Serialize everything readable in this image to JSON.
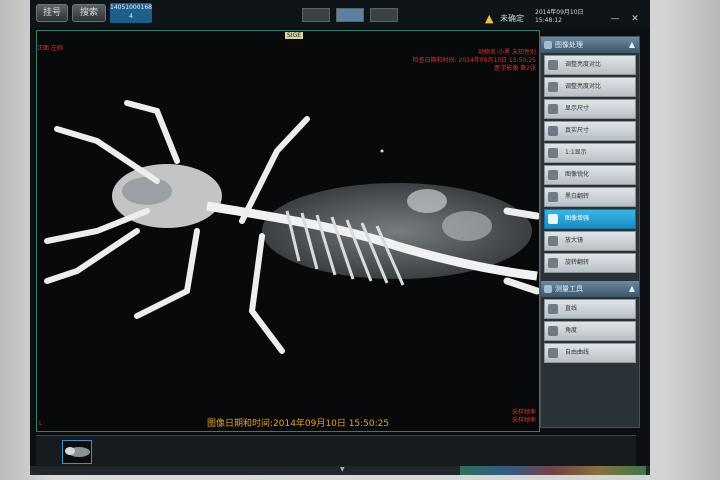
{
  "toolbar": {
    "btn_register": "挂号",
    "btn_search": "搜索",
    "patient_id": "14051000168",
    "id_suffix": "4",
    "warning_text": "未确定",
    "clock_date": "2014年09月10日",
    "clock_time": "15:48:12",
    "btn_minimize": "—",
    "btn_close": "✕"
  },
  "viewport": {
    "corner_tl": "正面 左侧",
    "marker": "SIGE",
    "meta_tr": [
      "动物名:小黑 未知性别",
      "检查日期和时间: 2014年09月10日 15:50:25",
      "医学影像 第2张"
    ],
    "meta_br": [
      "采样频率",
      "采样频率"
    ],
    "corner_bl": "L",
    "datestamp": "图像日期和时间:2014年09月10日 15:50:25"
  },
  "sidebar": {
    "panel1_title": "图像处理",
    "items": [
      {
        "label": "调整亮度对比",
        "icon": "brightness-icon",
        "active": false
      },
      {
        "label": "调整亮度对比",
        "icon": "contrast-icon",
        "active": false
      },
      {
        "label": "显示尺寸",
        "icon": "ruler-icon",
        "active": false
      },
      {
        "label": "真实尺寸",
        "icon": "actual-size-icon",
        "active": false
      },
      {
        "label": "1:1显示",
        "icon": "zoom-icon",
        "active": false
      },
      {
        "label": "图像锐化",
        "icon": "sharpen-icon",
        "active": false
      },
      {
        "label": "黑白翻转",
        "icon": "invert-icon",
        "active": false
      },
      {
        "label": "图像增强",
        "icon": "enhance-icon",
        "active": true
      },
      {
        "label": "放大镜",
        "icon": "magnifier-icon",
        "active": false
      },
      {
        "label": "旋转翻转",
        "icon": "rotate-icon",
        "active": false
      }
    ],
    "panel2_title": "测量工具",
    "items2": [
      {
        "label": "直线",
        "icon": "line-icon"
      },
      {
        "label": "角度",
        "icon": "angle-icon"
      },
      {
        "label": "自由曲线",
        "icon": "curve-icon"
      }
    ]
  },
  "colors": {
    "accent": "#1a8dc0",
    "overlay_text": "#d9342b",
    "datestamp": "#e5a02a",
    "viewport_border": "#2f7f6e"
  }
}
